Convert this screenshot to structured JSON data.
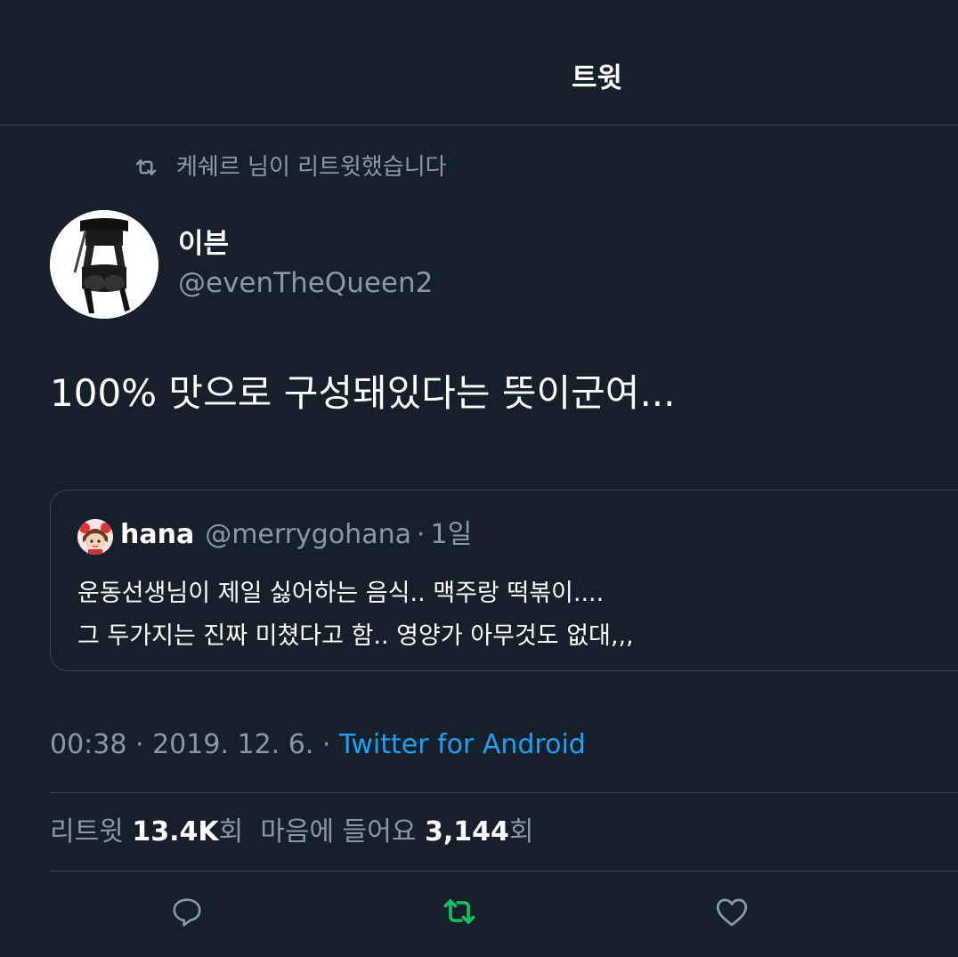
{
  "header": {
    "title": "트윗"
  },
  "retweet_context": {
    "text": "케쉐르 님이 리트윗했습니다"
  },
  "tweet": {
    "author_name": "이븐",
    "author_handle": "@evenTheQueen2",
    "text": "100% 맛으로 구성돼있다는 뜻이군여...",
    "meta": {
      "time": "00:38",
      "sep1": " · ",
      "date": "2019. 12. 6.",
      "sep2": " · ",
      "source": "Twitter for Android"
    },
    "stats": {
      "retweet_label": "리트윗",
      "retweet_count": "13.4K",
      "retweet_suffix": "회",
      "like_label": "마음에 들어요",
      "like_count": "3,144",
      "like_suffix": "회"
    }
  },
  "quoted_tweet": {
    "author_name": "hana",
    "author_handle": "@merrygohana",
    "dot": "·",
    "time": "1일",
    "line1": "운동선생님이 제일 싫어하는 음식.. 맥주랑 떡볶이....",
    "line2": "그 두가지는 진짜 미쳤다고 함.. 영양가 아무것도 없대,,,"
  },
  "actions": {
    "reply_icon": "reply-icon",
    "retweet_icon": "retweet-icon",
    "like_icon": "heart-icon"
  },
  "colors": {
    "background": "#15202b",
    "border": "#38444d",
    "secondary_text": "#8899a6",
    "link": "#1da1f2",
    "retweet_active": "#17bf63"
  }
}
